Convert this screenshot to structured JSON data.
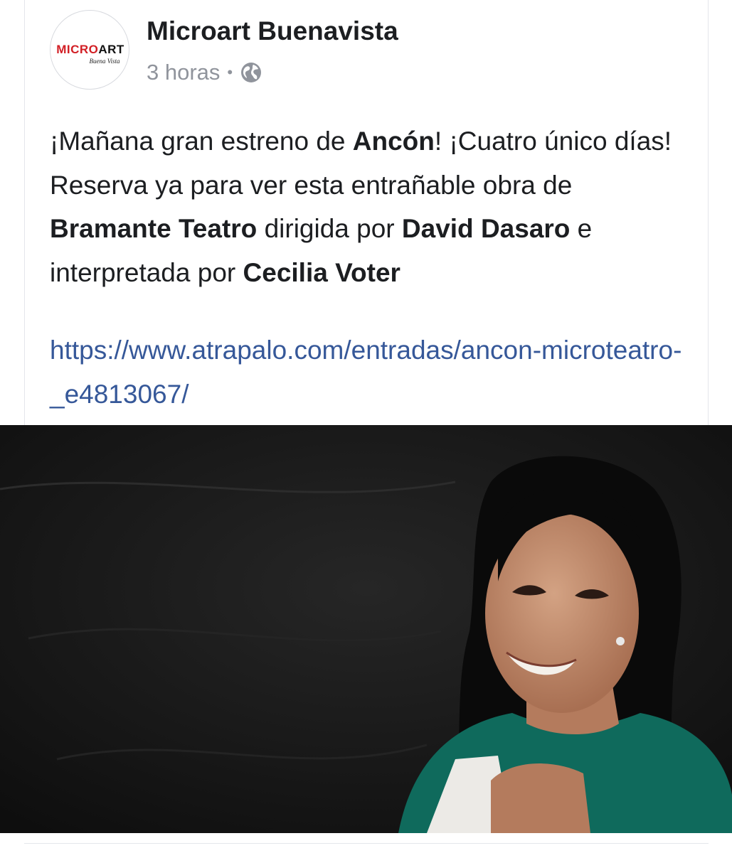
{
  "post": {
    "page_name": "Microart Buenavista",
    "timestamp": "3 horas",
    "separator": "•",
    "privacy_icon": "globe-icon",
    "avatar": {
      "logo_red": "MICRO",
      "logo_black": "ART",
      "logo_script": "Buena Vista"
    },
    "text": {
      "p1": "¡Mañana gran estreno de ",
      "b1": "Ancón",
      "p2": "! ¡Cuatro único días! Reserva ya para ver esta entrañable obra de ",
      "b2": "Bramante Teatro",
      "p3": " dirigida por ",
      "b3": "David Dasaro",
      "p4": " e interpretada por ",
      "b4": "Cecilia Voter"
    },
    "link": "https://www.atrapalo.com/entradas/ancon-microteatro-_e4813067/",
    "photo_alt": "photo-of-woman"
  },
  "colors": {
    "text": "#1c1e21",
    "meta": "#90949c",
    "link": "#365899",
    "logo_red": "#d21f25",
    "photo_bg": "#151515",
    "blouse": "#0f6a5c"
  }
}
